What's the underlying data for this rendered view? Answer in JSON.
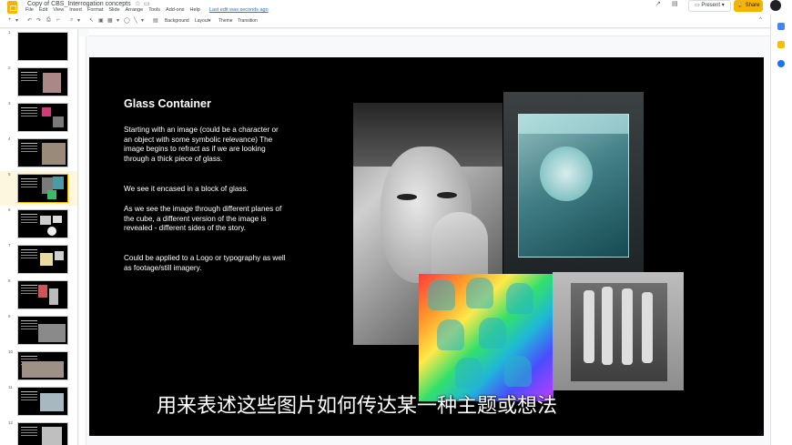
{
  "app": {
    "doc_title": "Copy of CBS_Interrogation concepts",
    "last_edit": "Last edit was seconds ago",
    "menu": [
      "File",
      "Edit",
      "View",
      "Insert",
      "Format",
      "Slide",
      "Arrange",
      "Tools",
      "Add-ons",
      "Help"
    ],
    "present_label": "Present",
    "share_label": "Share",
    "brand_color": "#f4b400"
  },
  "toolbar": {
    "background_label": "Background",
    "layout_label": "Layout",
    "theme_label": "Theme",
    "transition_label": "Transition"
  },
  "filmstrip": {
    "slides": [
      "1",
      "2",
      "3",
      "4",
      "5",
      "6",
      "7",
      "8",
      "9",
      "10",
      "11",
      "12"
    ],
    "selected": "5"
  },
  "slide": {
    "title": "Glass Container",
    "paragraphs": [
      "Starting with an image (could be a character or an object with some symbolic relevance) The image begins to refract as if we are looking through a thick piece of glass.",
      "We see it encased in a block of glass.",
      "As we see the image through different planes of the cube, a different version of the image is revealed - different sides of the story.",
      "Could be applied to a Logo or typography as well as footage/still imagery."
    ]
  },
  "subtitle": "用来表述这些图片如何传达某一种主题或想法"
}
